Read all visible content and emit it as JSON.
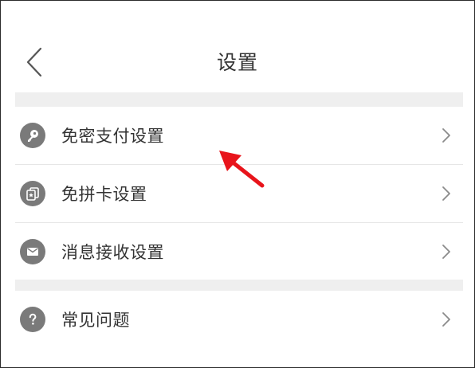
{
  "header": {
    "title": "设置"
  },
  "groups": [
    {
      "items": [
        {
          "label": "免密支付设置",
          "icon": "key-icon"
        },
        {
          "label": "免拼卡设置",
          "icon": "card-icon"
        },
        {
          "label": "消息接收设置",
          "icon": "mail-icon"
        }
      ]
    },
    {
      "items": [
        {
          "label": "常见问题",
          "icon": "question-icon"
        }
      ]
    }
  ],
  "colors": {
    "icon_bg": "#7a7a7a",
    "separator": "#efefef",
    "annotation_arrow": "#e8141b"
  }
}
